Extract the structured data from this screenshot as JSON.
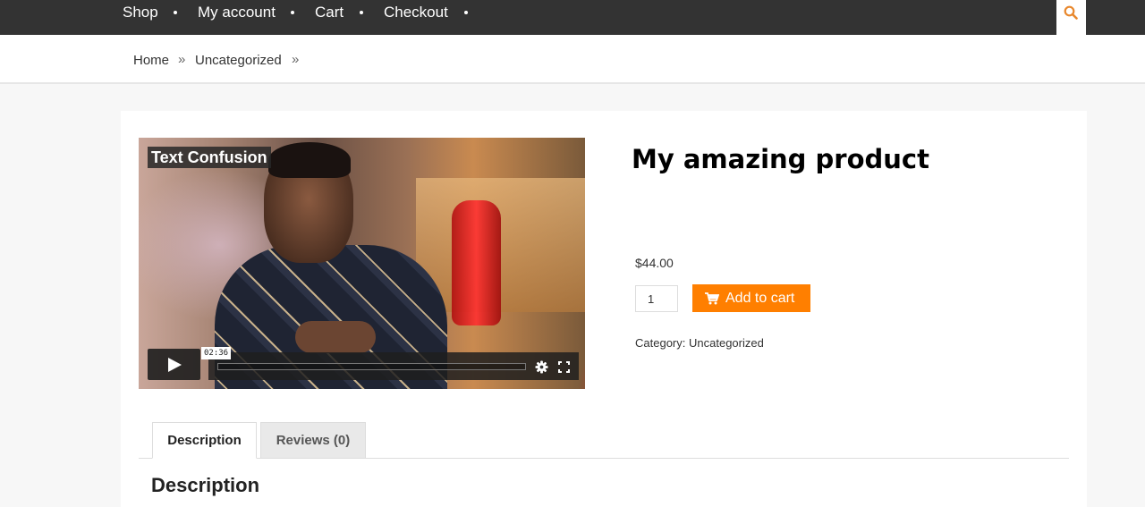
{
  "nav": {
    "items": [
      {
        "label": "Shop"
      },
      {
        "label": "My account"
      },
      {
        "label": "Cart"
      },
      {
        "label": "Checkout"
      }
    ],
    "search_icon": "search-icon",
    "accent_color": "#e8872c"
  },
  "breadcrumb": {
    "items": [
      {
        "label": "Home"
      },
      {
        "label": "Uncategorized"
      }
    ],
    "separator": "»"
  },
  "video": {
    "title": "Text Confusion",
    "duration": "02:36",
    "progress_fraction": 0.0,
    "icons": [
      "play-icon",
      "settings-gear-icon",
      "fullscreen-icon"
    ]
  },
  "product": {
    "title": "My amazing product",
    "price": "$44.00",
    "quantity": "1",
    "add_to_cart_label": "Add to cart",
    "button_color": "#ff7f00",
    "category_label": "Category:",
    "category_value": "Uncategorized"
  },
  "tabs": {
    "items": [
      {
        "label": "Description",
        "active": true
      },
      {
        "label": "Reviews (0)",
        "active": false
      }
    ],
    "heading": "Description"
  }
}
